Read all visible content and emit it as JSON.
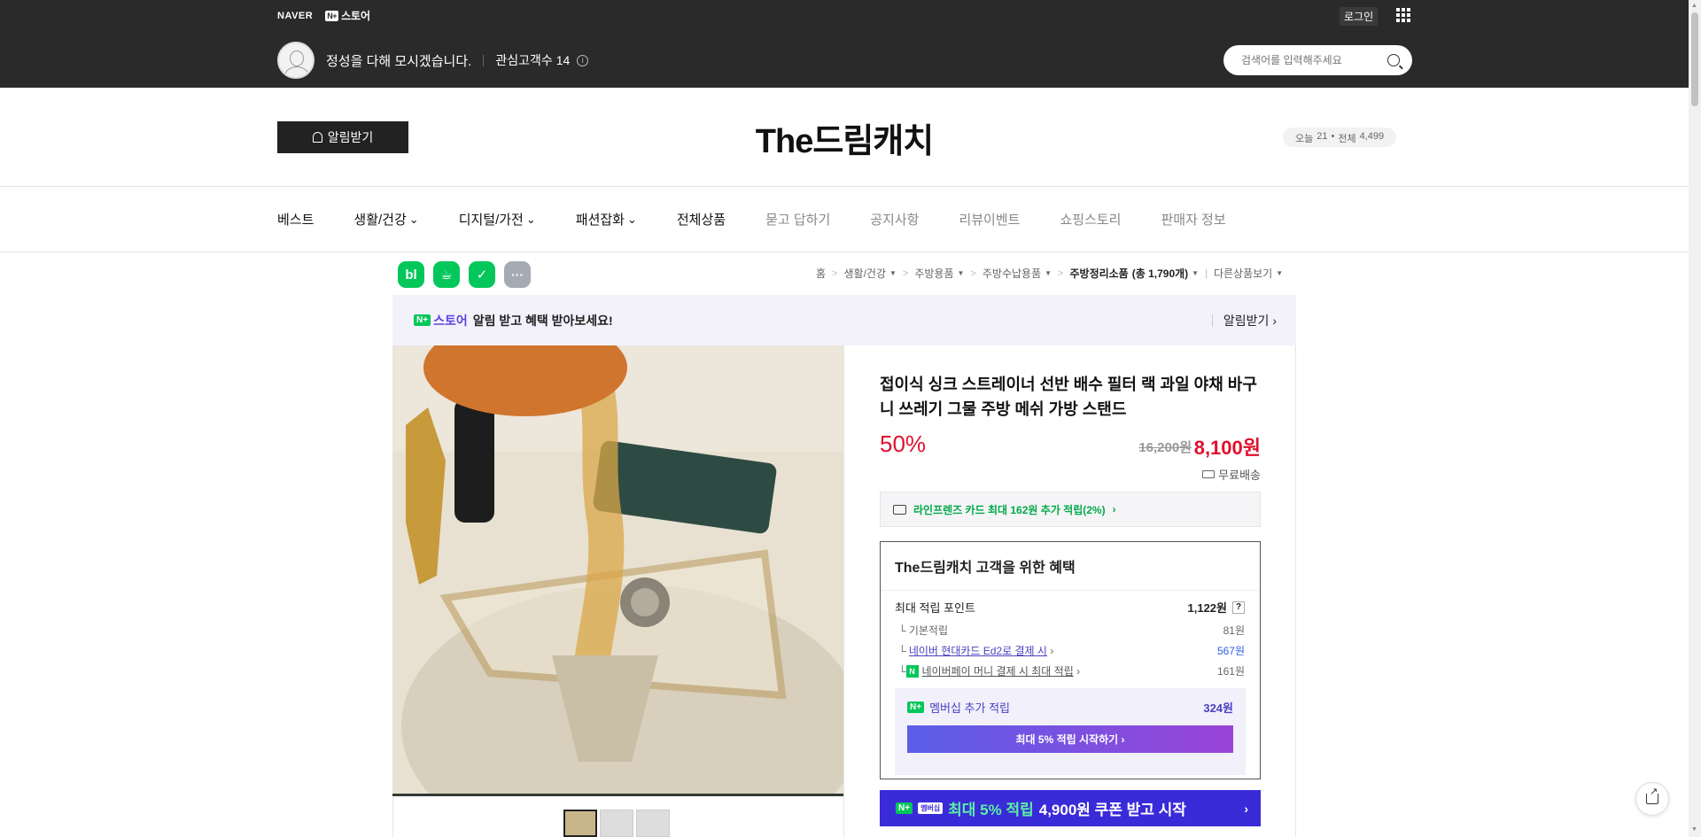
{
  "gnb": {
    "naver_logo": "NAVER",
    "nplus_badge": "N+",
    "store_label": "스토어",
    "login": "로그인"
  },
  "store": {
    "slogan": "정성을 다해 모시겠습니다.",
    "fans_label": "관심고객수",
    "fans_count": "14",
    "title": "The드림캐치",
    "notify_button": "알림받기",
    "visits": {
      "today_label": "오늘",
      "today": "21",
      "total_label": "전체",
      "total": "4,499"
    }
  },
  "search": {
    "placeholder": "검색어를 입력해주세요"
  },
  "menu": [
    {
      "label": "베스트",
      "dropdown": false,
      "dim": false
    },
    {
      "label": "생활/건강",
      "dropdown": true,
      "dim": false
    },
    {
      "label": "디지털/가전",
      "dropdown": true,
      "dim": false
    },
    {
      "label": "패션잡화",
      "dropdown": true,
      "dim": false
    },
    {
      "label": "전체상품",
      "dropdown": false,
      "dim": false
    },
    {
      "label": "묻고 답하기",
      "dropdown": false,
      "dim": true
    },
    {
      "label": "공지사항",
      "dropdown": false,
      "dim": true
    },
    {
      "label": "리뷰이벤트",
      "dropdown": false,
      "dim": true
    },
    {
      "label": "쇼핑스토리",
      "dropdown": false,
      "dim": true
    },
    {
      "label": "판매자 정보",
      "dropdown": false,
      "dim": true
    }
  ],
  "sns": [
    "bl",
    "☕",
    "✓",
    "···"
  ],
  "breadcrumb": {
    "items": [
      "홈",
      "생활/건강",
      "주방용품",
      "주방수납용품"
    ],
    "current": "주방정리소품",
    "count": "(총 1,790개)",
    "other": "다른상품보기"
  },
  "notice": {
    "store": "스토어",
    "text": "알림 받고 혜택 받아보세요!",
    "action": "알림받기"
  },
  "product": {
    "title": "접이식 싱크 스트레이너 선반 배수 필터 랙 과일 야채 바구니 쓰레기 그물 주방 메쉬 가방 스탠드",
    "discount": "50%",
    "original_price": "16,200원",
    "sale_price": "8,100원",
    "shipping": "무료배송",
    "card_benefit": "라인프렌즈 카드 최대 162원 추가 적립(2%)",
    "thumbnail_count": 3
  },
  "benefits": {
    "title": "The드림캐치 고객을 위한 혜택",
    "max_points_label": "최대 적립 포인트",
    "max_points": "1,122원",
    "rows": [
      {
        "label": "기본적립",
        "value": "81원"
      },
      {
        "label": "네이버 현대카드 Ed2로 결제 시",
        "value": "567원"
      },
      {
        "label": "네이버페이 머니 결제 시 최대 적립",
        "value": "161원"
      }
    ],
    "membership_label": "멤버십 추가 적립",
    "membership_value": "324원",
    "membership_button": "최대 5% 적립 시작하기",
    "coupon_pill": "멤버십",
    "coupon_green": "최대 5% 적립",
    "coupon_white": "4,900원 쿠폰 받고 시작"
  },
  "colors": {
    "top_bar": "#2a2a2a",
    "price_red": "#e0102d",
    "naver_green": "#03c75a",
    "membership_purple": "#3a2bd8"
  }
}
